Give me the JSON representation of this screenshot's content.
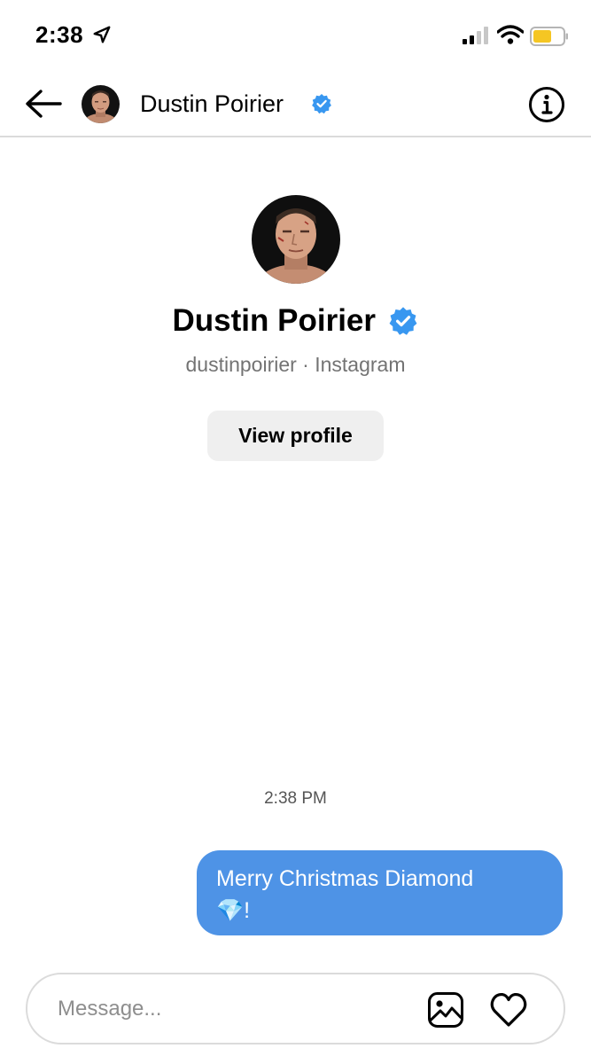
{
  "status_bar": {
    "time": "2:38",
    "icons": [
      "location-arrow-icon",
      "signal-icon",
      "wifi-icon",
      "battery-icon"
    ]
  },
  "header": {
    "name": "Dustin Poirier",
    "verified": true,
    "back_icon": "back-arrow-icon",
    "info_icon": "info-icon"
  },
  "profile": {
    "name": "Dustin Poirier",
    "subtitle": "dustinpoirier · Instagram",
    "view_profile_label": "View profile"
  },
  "conversation": {
    "timestamp": "2:38 PM",
    "messages": [
      {
        "sender": "me",
        "text": "Merry Christmas Diamond",
        "emoji": "💎",
        "suffix": "!"
      }
    ]
  },
  "composer": {
    "placeholder": "Message...",
    "value": "",
    "icons": [
      "gallery-icon",
      "heart-icon"
    ]
  },
  "colors": {
    "verified_blue": "#3897f0",
    "bubble_blue": "#4e93e6",
    "divider": "#dbdbdb",
    "button_bg": "#efefef",
    "battery_yellow": "#f5c623"
  }
}
